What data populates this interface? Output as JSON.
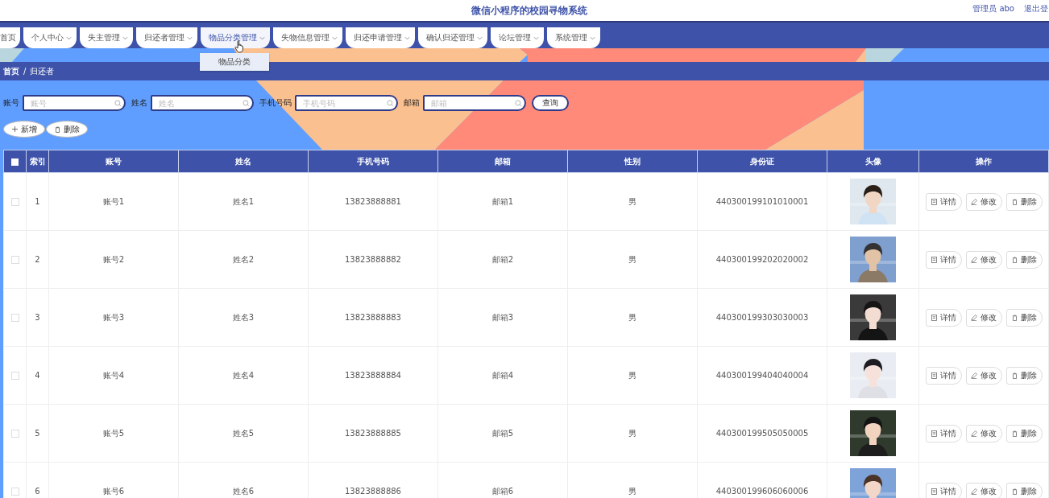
{
  "header": {
    "title": "微信小程序的校园寻物系统",
    "user": "管理员 abo",
    "logout": "退出登"
  },
  "nav": [
    {
      "label": "首页",
      "has_caret": false,
      "expanded": false
    },
    {
      "label": "个人中心",
      "has_caret": true,
      "expanded": false
    },
    {
      "label": "失主管理",
      "has_caret": true,
      "expanded": false
    },
    {
      "label": "归还者管理",
      "has_caret": true,
      "expanded": false
    },
    {
      "label": "物品分类管理",
      "has_caret": true,
      "expanded": true,
      "children": [
        "物品分类"
      ]
    },
    {
      "label": "失物信息管理",
      "has_caret": true,
      "expanded": false
    },
    {
      "label": "归还申请管理",
      "has_caret": true,
      "expanded": false
    },
    {
      "label": "确认归还管理",
      "has_caret": true,
      "expanded": false
    },
    {
      "label": "论坛管理",
      "has_caret": true,
      "expanded": false
    },
    {
      "label": "系统管理",
      "has_caret": true,
      "expanded": false
    }
  ],
  "breadcrumb": {
    "items": [
      "首页",
      "归还者"
    ],
    "separator": "/"
  },
  "search": {
    "fields": [
      {
        "label": "账号",
        "placeholder": "账号"
      },
      {
        "label": "姓名",
        "placeholder": "姓名"
      },
      {
        "label": "手机号码",
        "placeholder": "手机号码"
      },
      {
        "label": "邮箱",
        "placeholder": "邮箱"
      }
    ],
    "button": "查询"
  },
  "actions": [
    {
      "kind": "add",
      "label": "新增"
    },
    {
      "kind": "delete",
      "label": "删除"
    }
  ],
  "table": {
    "columns": [
      "索引",
      "账号",
      "姓名",
      "手机号码",
      "邮箱",
      "性别",
      "身份证",
      "头像",
      "操作"
    ],
    "all_checked": false,
    "rows": [
      {
        "checked": false,
        "cells": [
          "1",
          "账号1",
          "姓名1",
          "13823888881",
          "邮箱1",
          "男",
          "440300199101010001"
        ],
        "avatar": {
          "kind": "picture"
        },
        "actions": [
          {
            "kind": "detail",
            "label": "详情"
          },
          {
            "kind": "edit",
            "label": "修改"
          },
          {
            "kind": "delete",
            "label": "删除"
          }
        ]
      },
      {
        "checked": false,
        "cells": [
          "2",
          "账号2",
          "姓名2",
          "13823888882",
          "邮箱2",
          "男",
          "440300199202020002"
        ],
        "avatar": {
          "kind": "picture"
        },
        "actions": [
          {
            "kind": "detail",
            "label": "详情"
          },
          {
            "kind": "edit",
            "label": "修改"
          },
          {
            "kind": "delete",
            "label": "删除"
          }
        ]
      },
      {
        "checked": false,
        "cells": [
          "3",
          "账号3",
          "姓名3",
          "13823888883",
          "邮箱3",
          "男",
          "440300199303030003"
        ],
        "avatar": {
          "kind": "picture"
        },
        "actions": [
          {
            "kind": "detail",
            "label": "详情"
          },
          {
            "kind": "edit",
            "label": "修改"
          },
          {
            "kind": "delete",
            "label": "删除"
          }
        ]
      },
      {
        "checked": false,
        "cells": [
          "4",
          "账号4",
          "姓名4",
          "13823888884",
          "邮箱4",
          "男",
          "440300199404040004"
        ],
        "avatar": {
          "kind": "picture"
        },
        "actions": [
          {
            "kind": "detail",
            "label": "详情"
          },
          {
            "kind": "edit",
            "label": "修改"
          },
          {
            "kind": "delete",
            "label": "删除"
          }
        ]
      },
      {
        "checked": false,
        "cells": [
          "5",
          "账号5",
          "姓名5",
          "13823888885",
          "邮箱5",
          "男",
          "440300199505050005"
        ],
        "avatar": {
          "kind": "picture"
        },
        "actions": [
          {
            "kind": "detail",
            "label": "详情"
          },
          {
            "kind": "edit",
            "label": "修改"
          },
          {
            "kind": "delete",
            "label": "删除"
          }
        ]
      },
      {
        "checked": false,
        "cells": [
          "6",
          "账号6",
          "姓名6",
          "13823888886",
          "邮箱6",
          "男",
          "440300199606060006"
        ],
        "avatar": {
          "kind": "picture"
        },
        "actions": [
          {
            "kind": "detail",
            "label": "详情"
          },
          {
            "kind": "edit",
            "label": "修改"
          },
          {
            "kind": "delete",
            "label": "删除"
          }
        ]
      }
    ]
  }
}
